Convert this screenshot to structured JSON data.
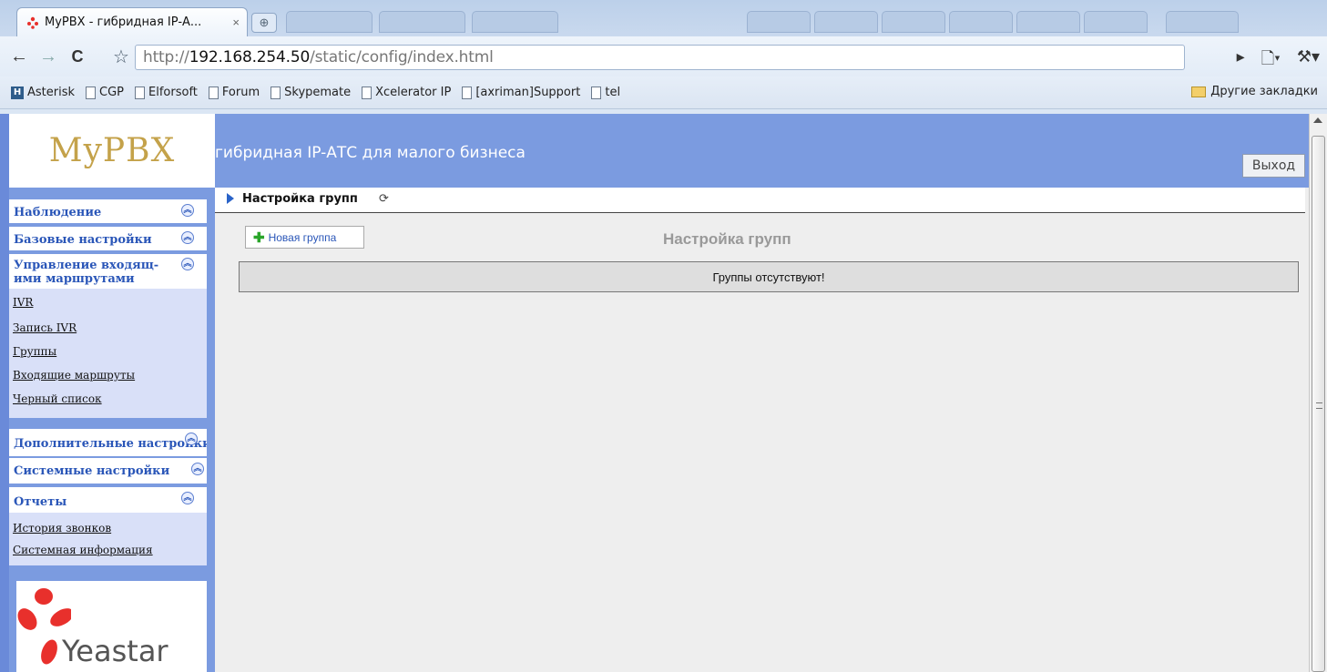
{
  "browser": {
    "tab_title": "MyPBX - гибридная IP-А...",
    "tab_close": "×",
    "url_scheme": "http://",
    "url_host": "192.168.254.50",
    "url_path": "/static/config/index.html",
    "bookmarks": [
      "Asterisk",
      "CGP",
      "Elforsoft",
      "Forum",
      "Skypemate",
      "Xcelerator IP",
      "[axriman]Support",
      "tel"
    ],
    "other_bookmarks": "Другие закладки"
  },
  "app": {
    "logo": "MyPBX",
    "banner_title": "гибридная IP-АТС для малого бизнеса",
    "logout_label": "Выход",
    "vendor_logo": "Yeastar"
  },
  "sidebar": {
    "sections": [
      "Наблюдение",
      "Базовые настройки",
      "Управление входящ-",
      "Дополнительные настройки",
      "Системные настройки",
      "Отчеты"
    ],
    "inbound_section_line2": "ими маршрутами",
    "inbound_items": [
      "IVR",
      "Запись IVR",
      "Группы",
      "Входящие маршруты",
      "Черный список"
    ],
    "report_items": [
      "История звонков",
      "Системная информация"
    ]
  },
  "content": {
    "breadcrumb": "Настройка групп",
    "new_group_label": "Новая группа",
    "section_title": "Настройка групп",
    "empty_message": "Группы отсутствуют!"
  },
  "colors": {
    "banner": "#7b9be0",
    "sidebar_link": "#2a56b8",
    "submenu_bg": "#d9e0f8",
    "yeastar_red": "#e8302c"
  }
}
